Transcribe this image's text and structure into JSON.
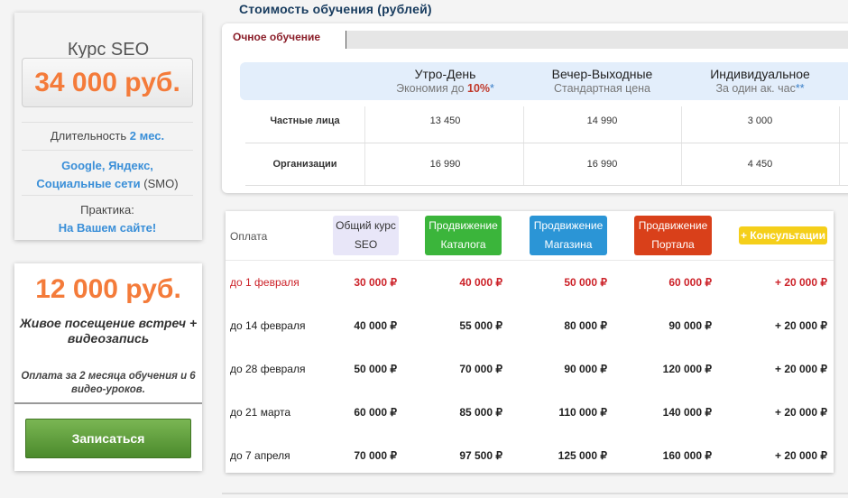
{
  "course": {
    "title": "Курс SEO",
    "price": "34 000 руб.",
    "duration_label": "Длительность",
    "duration_value": "2 мес.",
    "engines_line1": "Google, Яндекс,",
    "engines_line2_bold": "Социальные сети",
    "engines_line2_rest": " (SMO)",
    "practice_label": "Практика:",
    "practice_value": "На Вашем сайте!"
  },
  "offer": {
    "price": "12 000 руб.",
    "subtitle_line1": "Живое посещение встреч +",
    "subtitle_line2": "видеозапись",
    "note_line1": "Оплата за 2 месяца обучения и 6",
    "note_line2": "видео-уроков.",
    "button_label": "Записаться"
  },
  "pricing": {
    "heading": "Стоимость обучения (рублей)",
    "tab_label": "Очное обучение",
    "columns": [
      {
        "title": "Утро-День",
        "sub_prefix": "Экономия до ",
        "sub_highlight": "10%",
        "sub_star": "*"
      },
      {
        "title": "Вечер-Выходные",
        "sub_prefix": "Стандартная цена",
        "sub_highlight": "",
        "sub_star": ""
      },
      {
        "title": "Индивидуальное",
        "sub_prefix": "За один ак. час",
        "sub_highlight": "",
        "sub_star": "**"
      }
    ],
    "rows": [
      {
        "label": "Частные лица",
        "values": [
          "13 450",
          "14 990",
          "3 000"
        ]
      },
      {
        "label": "Организации",
        "values": [
          "16 990",
          "16 990",
          "4 450"
        ]
      }
    ]
  },
  "payment": {
    "label": "Оплата",
    "badges": {
      "general": [
        "Общий курс",
        "SEO"
      ],
      "catalog": [
        "Продвижение",
        "Каталога"
      ],
      "shop": [
        "Продвижение",
        "Магазина"
      ],
      "portal": [
        "Продвижение",
        "Портала"
      ],
      "consult": "+ Консультации"
    },
    "rows": [
      {
        "date": "до 1 февраля",
        "values": [
          "30 000 ₽",
          "40 000 ₽",
          "50 000 ₽",
          "60 000 ₽",
          "+ 20 000 ₽"
        ]
      },
      {
        "date": "до 14 февраля",
        "values": [
          "40 000 ₽",
          "55 000 ₽",
          "80 000 ₽",
          "90 000 ₽",
          "+ 20 000 ₽"
        ]
      },
      {
        "date": "до 28 февраля",
        "values": [
          "50 000 ₽",
          "70 000 ₽",
          "90 000 ₽",
          "120 000 ₽",
          "+ 20 000 ₽"
        ]
      },
      {
        "date": "до 21 марта",
        "values": [
          "60 000 ₽",
          "85 000 ₽",
          "110 000 ₽",
          "140 000 ₽",
          "+ 20 000 ₽"
        ]
      },
      {
        "date": "до 7 апреля",
        "values": [
          "70 000 ₽",
          "97 500 ₽",
          "125 000 ₽",
          "160 000 ₽",
          "+ 20 000 ₽"
        ]
      }
    ]
  }
}
